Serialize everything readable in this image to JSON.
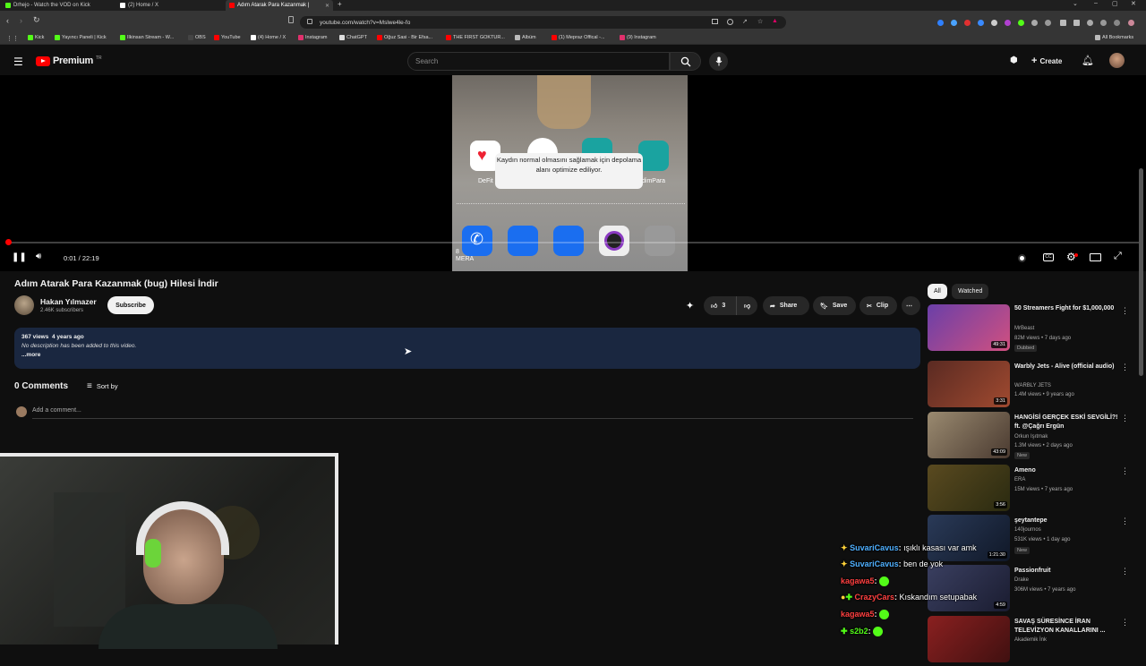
{
  "browser": {
    "tabs": [
      {
        "label": "Drhejo - Watch the VOD on Kick",
        "color": "#53fc18"
      },
      {
        "label": "(2) Home / X",
        "color": "#ffffff"
      },
      {
        "label": "Adım Atarak Para Kazanmak |",
        "color": "#ff0000",
        "active": true
      }
    ],
    "url": "youtube.com/watch?v=Mslwe4le-fo",
    "bookmarks": [
      {
        "label": "Kick",
        "color": "#53fc18"
      },
      {
        "label": "Yayıncı Paneli | Kick",
        "color": "#53fc18"
      },
      {
        "label": "Ilkinsan Stream - W...",
        "color": "#53fc18"
      },
      {
        "label": "OBS",
        "color": "#444444"
      },
      {
        "label": "YouTube",
        "color": "#ff0000"
      },
      {
        "label": "(4) Home / X",
        "color": "#ffffff"
      },
      {
        "label": "Instagram",
        "color": "#e1306c"
      },
      {
        "label": "ChatGPT",
        "color": "#dddddd"
      },
      {
        "label": "Oğuz Sasi - Bir Efsa...",
        "color": "#ff0000"
      },
      {
        "label": "THE FIRST GOKTUR...",
        "color": "#ff0000"
      },
      {
        "label": "Albüm",
        "color": "#bbbbbb"
      },
      {
        "label": "(1) Mepraz Offical -...",
        "color": "#ff0000"
      },
      {
        "label": "(9) Instagram",
        "color": "#e1306c"
      }
    ],
    "all_bookmarks": "All Bookmarks"
  },
  "youtube": {
    "logo": "Premium",
    "logo_sup": "TR",
    "search_placeholder": "Search",
    "create_label": "Create"
  },
  "player": {
    "time": "0:01 / 22:19",
    "progress_fraction": 0.0008,
    "frame_toast": "Kaydın normal olmasını sağlamak için depolama alanı optimize ediliyor.",
    "frame_label_left": "DeFit",
    "frame_label_right": "dimPara",
    "frame_bottom_text": "8\nMERA"
  },
  "video": {
    "title": "Adım Atarak Para Kazanmak (bug) Hilesi İndir",
    "channel": "Hakan Yılmazer",
    "subscribers": "2.46K subscribers",
    "subscribe_label": "Subscribe",
    "likes": "3",
    "share_label": "Share",
    "save_label": "Save",
    "clip_label": "Clip",
    "views": "367 views",
    "age": "4 years ago",
    "description": "No description has been added to this video.",
    "more_label": "...more"
  },
  "comments": {
    "count": "0 Comments",
    "sort_label": "Sort by",
    "add_placeholder": "Add a comment..."
  },
  "sidebar": {
    "chips": [
      "All",
      "Watched"
    ],
    "items": [
      {
        "title": "50 Streamers Fight for $1,000,000",
        "channel": "MrBeast",
        "meta": "82M views • 7 days ago",
        "badge": "Dubbed",
        "duration": "49:31",
        "thumb": "#6a3fa8"
      },
      {
        "title": "Warbly Jets - Alive (official audio)",
        "channel": "WARBLY JETS",
        "meta": "1.4M views • 9 years ago",
        "badge": "",
        "duration": "3:31",
        "thumb": "#5a2a22"
      },
      {
        "title": "HANGİSİ GERÇEK ESKİ SEVGİLİ?! ft. @Çağrı Ergün",
        "channel": "Orkun Işıtmak",
        "meta": "1.3M views • 2 days ago",
        "badge": "New",
        "duration": "43:09",
        "thumb": "#9a8a70"
      },
      {
        "title": "Ameno",
        "channel": "ERA",
        "meta": "15M views • 7 years ago",
        "badge": "",
        "duration": "3:56",
        "thumb": "#5a4a20"
      },
      {
        "title": "şeytantepe",
        "channel": "140journos",
        "meta": "531K views • 1 day ago",
        "badge": "New",
        "duration": "1:21:30",
        "thumb": "#2a3a58"
      },
      {
        "title": "Passionfruit",
        "channel": "Drake",
        "meta": "306M views • 7 years ago",
        "badge": "",
        "duration": "4:59",
        "thumb": "#3a3f60"
      },
      {
        "title": "SAVAŞ SÜRESİNCE İRAN TELEVİZYON KANALLARINI ...",
        "channel": "Akademik İnk",
        "meta": "",
        "badge": "",
        "duration": "",
        "thumb": "#8a2020"
      }
    ]
  },
  "chat": [
    {
      "user": "SuvariCavus",
      "message": "ışıklı kasası var amk",
      "color": "#4fb0ff"
    },
    {
      "user": "SuvariCavus",
      "message": "ben de yok",
      "color": "#4fb0ff"
    },
    {
      "user": "kagawa5",
      "message": "",
      "color": "#ff4040"
    },
    {
      "user": "CrazyCars",
      "message": "Kıskandım setupabak",
      "color": "#ff4040"
    },
    {
      "user": "kagawa5",
      "message": "",
      "color": "#ff4040"
    },
    {
      "user": "s2b2",
      "message": "",
      "color": "#53fc18"
    }
  ]
}
